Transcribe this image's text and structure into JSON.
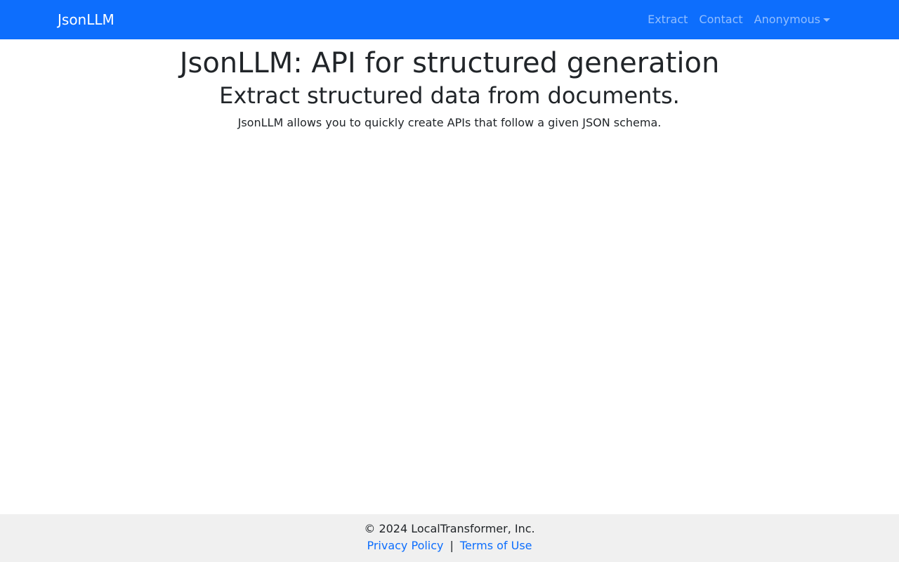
{
  "navbar": {
    "brand": "JsonLLM",
    "links": {
      "extract": "Extract",
      "contact": "Contact",
      "user": "Anonymous"
    },
    "background_color": "#0d6efd"
  },
  "hero": {
    "title": "JsonLLM: API for structured generation",
    "subtitle": "Extract structured data from documents.",
    "description": "JsonLLM allows you to quickly create APIs that follow a given JSON schema."
  },
  "footer": {
    "copyright": "© 2024 LocalTransformer, Inc.",
    "privacy": "Privacy Policy",
    "separator": "|",
    "terms": "Terms of Use",
    "link_color": "#0d6efd",
    "background_color": "#f0f0f0"
  }
}
